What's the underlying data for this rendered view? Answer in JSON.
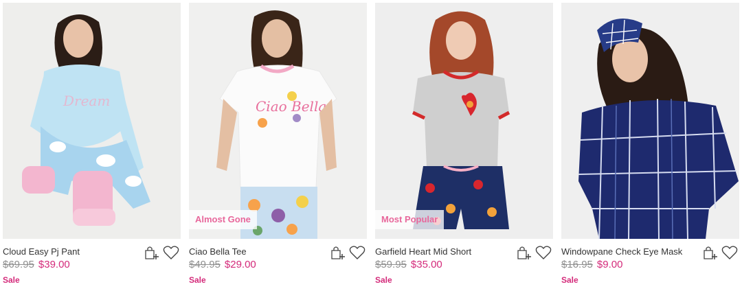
{
  "products": [
    {
      "name": "Cloud Easy Pj Pant",
      "old_price": "$69.95",
      "price": "$39.00",
      "tag": "Sale",
      "badge": ""
    },
    {
      "name": "Ciao Bella Tee",
      "old_price": "$49.95",
      "price": "$29.00",
      "tag": "Sale",
      "badge": "Almost Gone"
    },
    {
      "name": "Garfield Heart Mid Short",
      "old_price": "$59.95",
      "price": "$35.00",
      "tag": "Sale",
      "badge": "Most Popular"
    },
    {
      "name": "Windowpane Check Eye Mask",
      "old_price": "$16.95",
      "price": "$9.00",
      "tag": "Sale",
      "badge": ""
    }
  ],
  "icons": {
    "add_to_bag": "add-to-bag-icon",
    "wishlist": "heart-icon"
  },
  "colors": {
    "sale_pink": "#d42a7a",
    "badge_pink": "#e8679b",
    "old_price_grey": "#8f8f8f"
  },
  "t_shirt_print": "Ciao Bella"
}
